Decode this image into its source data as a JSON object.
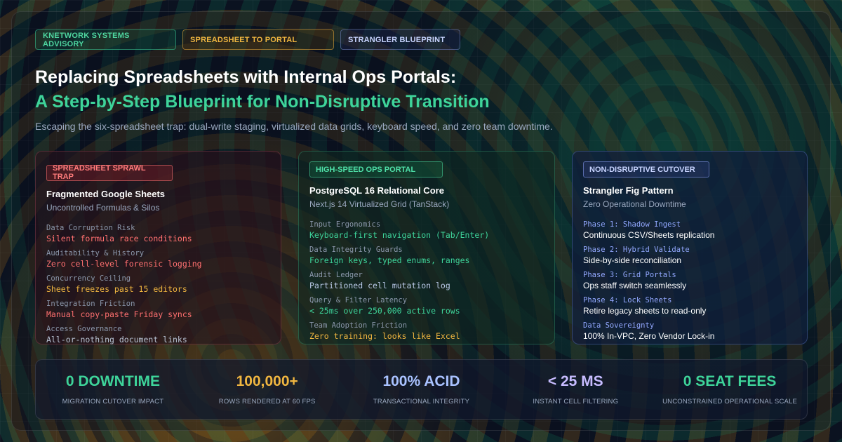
{
  "tags": [
    "KNETWORK SYSTEMS ADVISORY",
    "SPREADSHEET TO PORTAL",
    "STRANGLER BLUEPRINT"
  ],
  "header": {
    "title": "Replacing Spreadsheets with Internal Ops Portals:",
    "title_highlight": "A Step-by-Step Blueprint for Non-Disruptive Transition",
    "subtitle": "Escaping the six-spreadsheet trap: dual-write staging, virtualized data grids, keyboard speed, and zero team downtime."
  },
  "cards": [
    {
      "badge": "SPREADSHEET SPRAWL TRAP",
      "title": "Fragmented Google Sheets",
      "subtitle": "Uncontrolled Formulas & Silos",
      "rows": [
        {
          "k": "Data Corruption Risk",
          "v": "Silent formula race conditions"
        },
        {
          "k": "Auditability & History",
          "v": "Zero cell-level forensic logging"
        },
        {
          "k": "Concurrency Ceiling",
          "v": "Sheet freezes past 15 editors"
        },
        {
          "k": "Integration Friction",
          "v": "Manual copy-paste Friday syncs"
        },
        {
          "k": "Access Governance",
          "v": "All-or-nothing document links"
        }
      ]
    },
    {
      "badge": "HIGH-SPEED OPS PORTAL",
      "title": "PostgreSQL 16 Relational Core",
      "subtitle": "Next.js 14 Virtualized Grid (TanStack)",
      "rows": [
        {
          "k": "Input Ergonomics",
          "v": "Keyboard-first navigation (Tab/Enter)"
        },
        {
          "k": "Data Integrity Guards",
          "v": "Foreign keys, typed enums, ranges"
        },
        {
          "k": "Audit Ledger",
          "v": "Partitioned cell mutation log"
        },
        {
          "k": "Query & Filter Latency",
          "v": "< 25ms over 250,000 active rows"
        },
        {
          "k": "Team Adoption Friction",
          "v": "Zero training: looks like Excel"
        }
      ]
    },
    {
      "badge": "NON-DISRUPTIVE CUTOVER",
      "title": "Strangler Fig Pattern",
      "subtitle": "Zero Operational Downtime",
      "rows": [
        {
          "k": "Phase 1: Shadow Ingest",
          "v": "Continuous CSV/Sheets replication"
        },
        {
          "k": "Phase 2: Hybrid Validate",
          "v": "Side-by-side reconciliation"
        },
        {
          "k": "Phase 3: Grid Portals",
          "v": "Ops staff switch seamlessly"
        },
        {
          "k": "Phase 4: Lock Sheets",
          "v": "Retire legacy sheets to read-only"
        },
        {
          "k": "Data Sovereignty",
          "v": "100% In-VPC, Zero Vendor Lock-in"
        }
      ]
    }
  ],
  "stats": [
    {
      "value": "0 DOWNTIME",
      "label": "MIGRATION CUTOVER IMPACT",
      "color": "#3ed49a"
    },
    {
      "value": "100,000+",
      "label": "ROWS RENDERED AT 60 FPS",
      "color": "#f0b640"
    },
    {
      "value": "100% ACID",
      "label": "TRANSACTIONAL INTEGRITY",
      "color": "#a9c2ff"
    },
    {
      "value": "< 25 MS",
      "label": "INSTANT CELL FILTERING",
      "color": "#c7bcff"
    },
    {
      "value": "0 SEAT FEES",
      "label": "UNCONSTRAINED OPERATIONAL SCALE",
      "color": "#3ed49a"
    }
  ]
}
